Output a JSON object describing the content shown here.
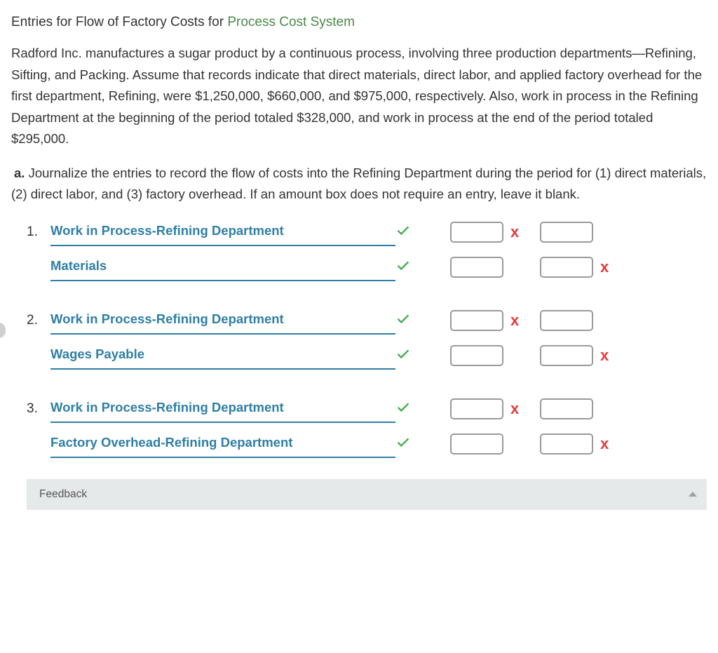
{
  "heading": {
    "text_before": "Entries for Flow of Factory Costs for ",
    "link_text": "Process Cost System"
  },
  "paragraph": "Radford Inc. manufactures a sugar product by a continuous process, involving three production departments—Refining, Sifting, and Packing. Assume that records indicate that direct materials, direct labor, and applied factory overhead for the first department, Refining, were $1,250,000, $660,000, and $975,000, respectively. Also, work in process in the Refining Department at the beginning of the period totaled $328,000, and work in process at the end of the period totaled $295,000.",
  "instruction": {
    "part_letter": "a.",
    "text": " Journalize the entries to record the flow of costs into the Refining Department during the period for (1) direct materials, (2) direct labor, and (3) factory overhead. If an amount box does not require an entry, leave it blank."
  },
  "entries": [
    {
      "num": "1.",
      "rows": [
        {
          "account": "Work in Process-Refining Department",
          "account_correct": true,
          "debit_mark": "x",
          "credit_mark": ""
        },
        {
          "account": "Materials",
          "account_correct": true,
          "debit_mark": "",
          "credit_mark": "x"
        }
      ]
    },
    {
      "num": "2.",
      "rows": [
        {
          "account": "Work in Process-Refining Department",
          "account_correct": true,
          "debit_mark": "x",
          "credit_mark": ""
        },
        {
          "account": "Wages Payable",
          "account_correct": true,
          "debit_mark": "",
          "credit_mark": "x"
        }
      ]
    },
    {
      "num": "3.",
      "rows": [
        {
          "account": "Work in Process-Refining Department",
          "account_correct": true,
          "debit_mark": "x",
          "credit_mark": ""
        },
        {
          "account": "Factory Overhead-Refining Department",
          "account_correct": true,
          "debit_mark": "",
          "credit_mark": "x"
        }
      ]
    }
  ],
  "feedback_label": "Feedback"
}
